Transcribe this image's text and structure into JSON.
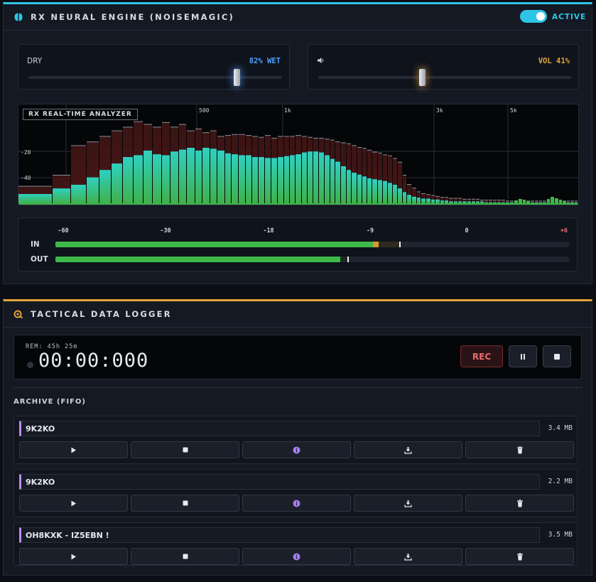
{
  "engine": {
    "title": "RX NEURAL ENGINE (NOISEMAGIC)",
    "status_label": "ACTIVE",
    "toggle_on": true,
    "accent": "#2fc5e8",
    "mix": {
      "left_label": "DRY",
      "value_label": "82% WET",
      "value": 0.82,
      "color": "#4aa3ff"
    },
    "volume": {
      "icon": "speaker-icon",
      "value_label": "VOL 41%",
      "value": 0.41,
      "color": "#e0a23a"
    }
  },
  "analyzer": {
    "title": "RX REAL-TIME ANALYZER",
    "freq_labels": [
      "500",
      "1k",
      "3k",
      "5k"
    ],
    "db_labels": [
      "-20",
      "-40"
    ],
    "chart_data": {
      "type": "bar",
      "title": "RX REAL-TIME ANALYZER",
      "x_tick_labels": [
        "500",
        "1k",
        "3k",
        "5k"
      ],
      "y_tick_labels": [
        "-20",
        "-40"
      ],
      "series": [
        {
          "values": [
            10,
            16,
            20,
            28,
            36,
            43,
            50,
            52,
            57,
            53,
            52,
            56,
            58,
            60,
            57,
            60,
            59,
            57,
            54,
            53,
            52,
            52,
            50,
            50,
            49,
            49,
            50,
            51,
            52,
            53,
            55,
            56,
            56,
            55,
            52,
            48,
            45,
            40,
            36,
            33,
            31,
            29,
            27,
            26,
            25,
            24,
            22,
            20,
            16,
            12,
            9,
            7,
            6,
            5,
            5,
            4,
            4,
            3,
            3,
            2,
            2,
            2,
            2,
            2,
            2,
            2,
            2,
            1,
            1,
            1,
            1,
            1,
            1,
            1,
            1,
            1,
            1,
            1,
            1,
            1,
            1,
            1,
            1,
            1,
            1,
            1,
            1,
            1,
            1,
            1
          ]
        },
        {
          "values": [
            18,
            30,
            62,
            66,
            72,
            78,
            82,
            88,
            85,
            82,
            87,
            82,
            85,
            78,
            80,
            76,
            78,
            72,
            73,
            74,
            74,
            73,
            72,
            71,
            73,
            70,
            72,
            72,
            72,
            73,
            72,
            71,
            70,
            70,
            69,
            68,
            66,
            65,
            64,
            62,
            60,
            59,
            57,
            55,
            54,
            52,
            51,
            48,
            44,
            30,
            20,
            16,
            12,
            10,
            9,
            8,
            7,
            6,
            6,
            5,
            5,
            5,
            4,
            4,
            4,
            4,
            3,
            3,
            3,
            3,
            3,
            3,
            2,
            2,
            2,
            2,
            2,
            2,
            2,
            2,
            2,
            2,
            2,
            2,
            2,
            2,
            2,
            2,
            2,
            2
          ]
        },
        {
          "values": [
            0,
            0,
            0,
            0,
            0,
            0,
            0,
            0,
            0,
            0,
            0,
            0,
            0,
            0,
            0,
            0,
            0,
            0,
            0,
            0,
            0,
            0,
            0,
            0,
            0,
            0,
            0,
            0,
            0,
            0,
            0,
            0,
            0,
            0,
            0,
            0,
            0,
            0,
            0,
            0,
            0,
            0,
            0,
            0,
            0,
            0,
            0,
            0,
            0,
            0,
            0,
            0,
            0,
            0,
            0,
            0,
            0,
            0,
            0,
            0,
            0,
            0,
            0,
            0,
            0,
            0,
            0,
            0,
            0,
            0,
            0,
            0,
            0,
            0,
            4,
            6,
            5,
            3,
            0,
            0,
            0,
            0,
            6,
            9,
            7,
            5,
            3,
            0,
            0,
            0
          ]
        }
      ]
    }
  },
  "meters": {
    "scale": [
      "-60",
      "-30",
      "-18",
      "-9",
      "0",
      "+6"
    ],
    "in": {
      "label": "IN",
      "level": 0.63,
      "peak": 0.67
    },
    "out": {
      "label": "OUT",
      "level": 0.555,
      "peak": 0.568
    }
  },
  "logger": {
    "title": "TACTICAL DATA LOGGER",
    "accent": "#e0a23a",
    "remaining": "REM: 45h 25m",
    "timer": "00:00:000",
    "rec_label": "REC",
    "archive_label": "ARCHIVE (FIFO)",
    "items": [
      {
        "name": "9K2KO",
        "size": "3.4 MB"
      },
      {
        "name": "9K2KO",
        "size": "2.2 MB"
      },
      {
        "name": "OH8KXK - IZ5EBN !",
        "size": "3.5 MB"
      }
    ]
  }
}
